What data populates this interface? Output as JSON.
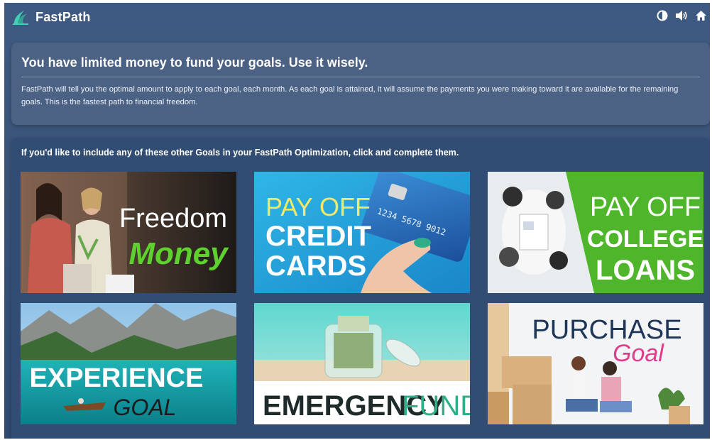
{
  "app": {
    "title": "FastPath"
  },
  "topbar_icons": [
    "contrast-icon",
    "volume-icon",
    "home-icon"
  ],
  "intro": {
    "headline": "You have limited money to fund your goals. Use it wisely.",
    "description": "FastPath will tell you the optimal amount to apply to each goal, each month. As each goal is attained, it will assume the payments you were making toward it are available for the remaining goals. This is the fastest path to financial freedom."
  },
  "goals": {
    "prompt": "If you'd like to include any of these other Goals in your FastPath Optimization, click and complete them.",
    "tiles": [
      {
        "line1": "Freedom",
        "line2": "Money"
      },
      {
        "line1": "PAY OFF",
        "line2": "CREDIT",
        "line3": "CARDS"
      },
      {
        "line1": "PAY OFF",
        "line2": "COLLEGE",
        "line3": "LOANS"
      },
      {
        "line1": "EXPERIENCE",
        "line2": "GOAL"
      },
      {
        "line1": "EMERGENCY",
        "line2": "FUND"
      },
      {
        "line1": "PURCHASE",
        "line2": "Goal"
      }
    ]
  },
  "colors": {
    "accent_green": "#5fd12f",
    "logo_teal": "#3fcfb4",
    "panel_bg": "#4b6285",
    "app_bg": "#3a5478"
  }
}
